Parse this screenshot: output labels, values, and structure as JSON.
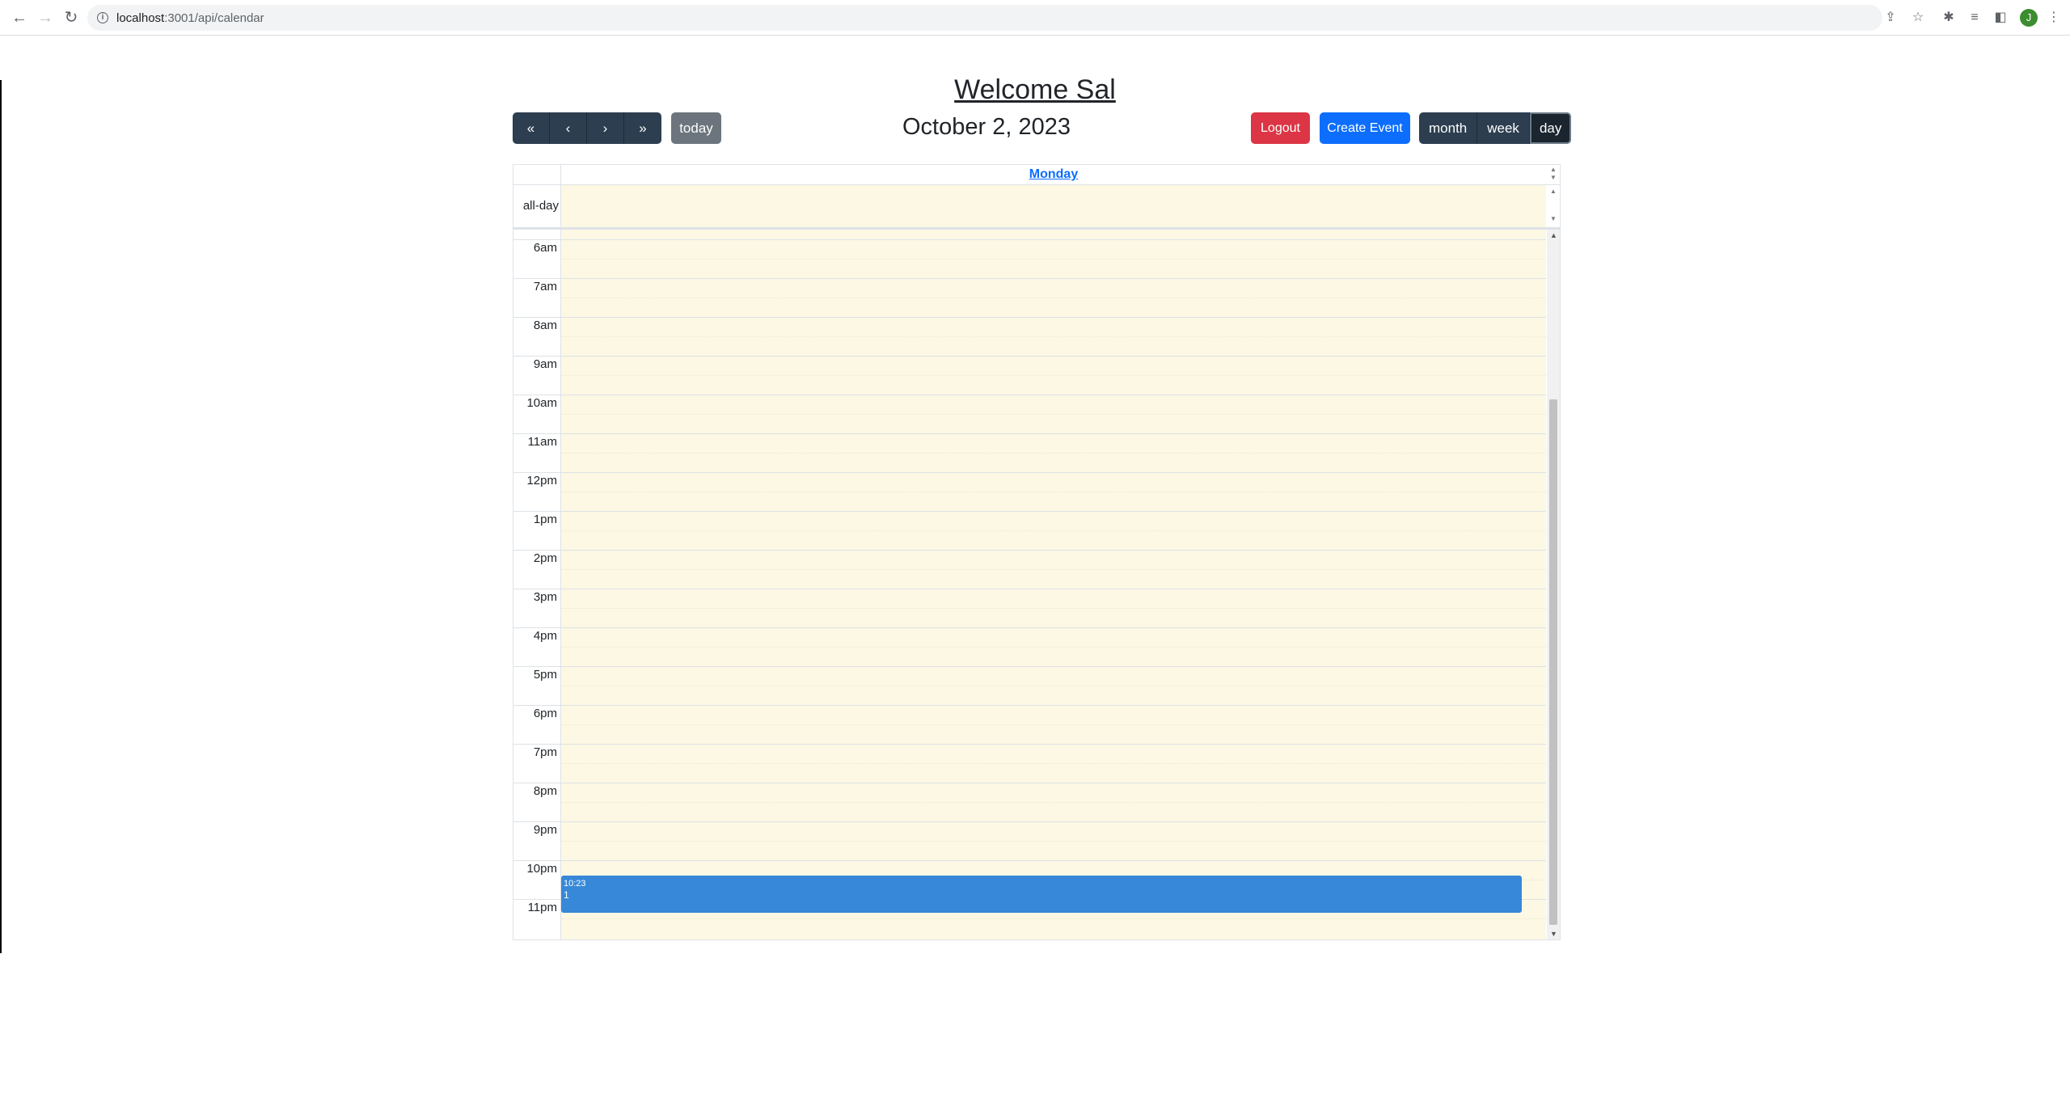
{
  "browser": {
    "url_host": "localhost",
    "url_path": ":3001/api/calendar",
    "profile_initial": "J",
    "icons": [
      "back-arrow-icon",
      "forward-arrow-icon",
      "reload-icon",
      "info-icon",
      "share-icon",
      "star-icon",
      "puzzle-icon",
      "media-icon",
      "side-panel-icon",
      "kebab-menu-icon"
    ]
  },
  "app": {
    "welcome": "Welcome Sal",
    "toolbar": {
      "prev_year": "«",
      "prev": "‹",
      "next": "›",
      "next_year": "»",
      "today": "today",
      "title": "October 2, 2023",
      "logout": "Logout",
      "create_event": "Create Event",
      "views": [
        "month",
        "week",
        "day"
      ],
      "active_view": "day"
    },
    "calendar": {
      "day_header": "Monday",
      "allday_label": "all-day",
      "hours": [
        "6am",
        "7am",
        "8am",
        "9am",
        "10am",
        "11am",
        "12pm",
        "1pm",
        "2pm",
        "3pm",
        "4pm",
        "5pm",
        "6pm",
        "7pm",
        "8pm",
        "9pm",
        "10pm",
        "11pm"
      ],
      "event": {
        "time": "10:23",
        "title": "1"
      }
    },
    "colors": {
      "primary_dark": "#2c3e50",
      "today_bg": "#6c757d",
      "logout_bg": "#dc3545",
      "create_bg": "#0d6efd",
      "today_highlight": "#fcf8e3",
      "event_bg": "#3788d8"
    }
  }
}
